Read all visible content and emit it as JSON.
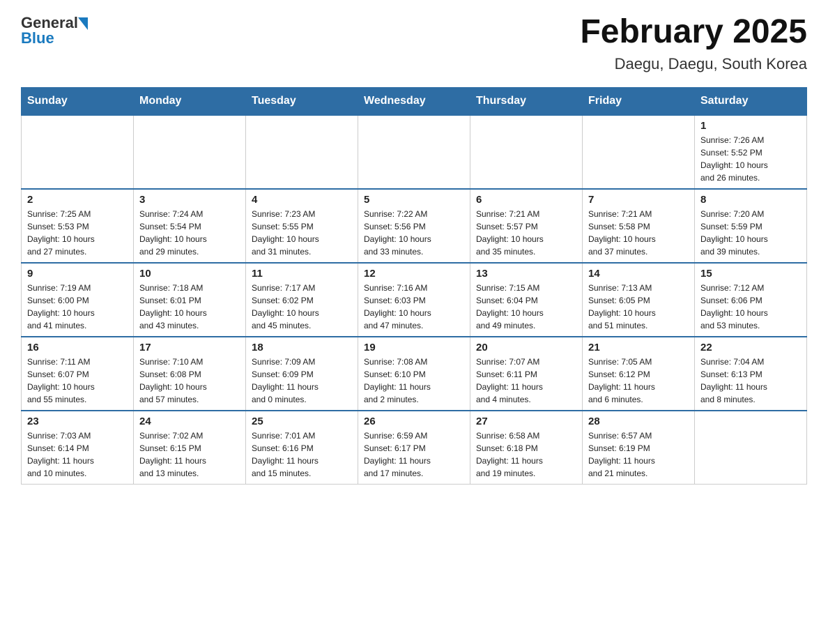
{
  "header": {
    "title": "February 2025",
    "subtitle": "Daegu, Daegu, South Korea",
    "logo_general": "General",
    "logo_blue": "Blue"
  },
  "weekdays": [
    "Sunday",
    "Monday",
    "Tuesday",
    "Wednesday",
    "Thursday",
    "Friday",
    "Saturday"
  ],
  "weeks": [
    [
      {
        "day": "",
        "info": ""
      },
      {
        "day": "",
        "info": ""
      },
      {
        "day": "",
        "info": ""
      },
      {
        "day": "",
        "info": ""
      },
      {
        "day": "",
        "info": ""
      },
      {
        "day": "",
        "info": ""
      },
      {
        "day": "1",
        "info": "Sunrise: 7:26 AM\nSunset: 5:52 PM\nDaylight: 10 hours\nand 26 minutes."
      }
    ],
    [
      {
        "day": "2",
        "info": "Sunrise: 7:25 AM\nSunset: 5:53 PM\nDaylight: 10 hours\nand 27 minutes."
      },
      {
        "day": "3",
        "info": "Sunrise: 7:24 AM\nSunset: 5:54 PM\nDaylight: 10 hours\nand 29 minutes."
      },
      {
        "day": "4",
        "info": "Sunrise: 7:23 AM\nSunset: 5:55 PM\nDaylight: 10 hours\nand 31 minutes."
      },
      {
        "day": "5",
        "info": "Sunrise: 7:22 AM\nSunset: 5:56 PM\nDaylight: 10 hours\nand 33 minutes."
      },
      {
        "day": "6",
        "info": "Sunrise: 7:21 AM\nSunset: 5:57 PM\nDaylight: 10 hours\nand 35 minutes."
      },
      {
        "day": "7",
        "info": "Sunrise: 7:21 AM\nSunset: 5:58 PM\nDaylight: 10 hours\nand 37 minutes."
      },
      {
        "day": "8",
        "info": "Sunrise: 7:20 AM\nSunset: 5:59 PM\nDaylight: 10 hours\nand 39 minutes."
      }
    ],
    [
      {
        "day": "9",
        "info": "Sunrise: 7:19 AM\nSunset: 6:00 PM\nDaylight: 10 hours\nand 41 minutes."
      },
      {
        "day": "10",
        "info": "Sunrise: 7:18 AM\nSunset: 6:01 PM\nDaylight: 10 hours\nand 43 minutes."
      },
      {
        "day": "11",
        "info": "Sunrise: 7:17 AM\nSunset: 6:02 PM\nDaylight: 10 hours\nand 45 minutes."
      },
      {
        "day": "12",
        "info": "Sunrise: 7:16 AM\nSunset: 6:03 PM\nDaylight: 10 hours\nand 47 minutes."
      },
      {
        "day": "13",
        "info": "Sunrise: 7:15 AM\nSunset: 6:04 PM\nDaylight: 10 hours\nand 49 minutes."
      },
      {
        "day": "14",
        "info": "Sunrise: 7:13 AM\nSunset: 6:05 PM\nDaylight: 10 hours\nand 51 minutes."
      },
      {
        "day": "15",
        "info": "Sunrise: 7:12 AM\nSunset: 6:06 PM\nDaylight: 10 hours\nand 53 minutes."
      }
    ],
    [
      {
        "day": "16",
        "info": "Sunrise: 7:11 AM\nSunset: 6:07 PM\nDaylight: 10 hours\nand 55 minutes."
      },
      {
        "day": "17",
        "info": "Sunrise: 7:10 AM\nSunset: 6:08 PM\nDaylight: 10 hours\nand 57 minutes."
      },
      {
        "day": "18",
        "info": "Sunrise: 7:09 AM\nSunset: 6:09 PM\nDaylight: 11 hours\nand 0 minutes."
      },
      {
        "day": "19",
        "info": "Sunrise: 7:08 AM\nSunset: 6:10 PM\nDaylight: 11 hours\nand 2 minutes."
      },
      {
        "day": "20",
        "info": "Sunrise: 7:07 AM\nSunset: 6:11 PM\nDaylight: 11 hours\nand 4 minutes."
      },
      {
        "day": "21",
        "info": "Sunrise: 7:05 AM\nSunset: 6:12 PM\nDaylight: 11 hours\nand 6 minutes."
      },
      {
        "day": "22",
        "info": "Sunrise: 7:04 AM\nSunset: 6:13 PM\nDaylight: 11 hours\nand 8 minutes."
      }
    ],
    [
      {
        "day": "23",
        "info": "Sunrise: 7:03 AM\nSunset: 6:14 PM\nDaylight: 11 hours\nand 10 minutes."
      },
      {
        "day": "24",
        "info": "Sunrise: 7:02 AM\nSunset: 6:15 PM\nDaylight: 11 hours\nand 13 minutes."
      },
      {
        "day": "25",
        "info": "Sunrise: 7:01 AM\nSunset: 6:16 PM\nDaylight: 11 hours\nand 15 minutes."
      },
      {
        "day": "26",
        "info": "Sunrise: 6:59 AM\nSunset: 6:17 PM\nDaylight: 11 hours\nand 17 minutes."
      },
      {
        "day": "27",
        "info": "Sunrise: 6:58 AM\nSunset: 6:18 PM\nDaylight: 11 hours\nand 19 minutes."
      },
      {
        "day": "28",
        "info": "Sunrise: 6:57 AM\nSunset: 6:19 PM\nDaylight: 11 hours\nand 21 minutes."
      },
      {
        "day": "",
        "info": ""
      }
    ]
  ]
}
